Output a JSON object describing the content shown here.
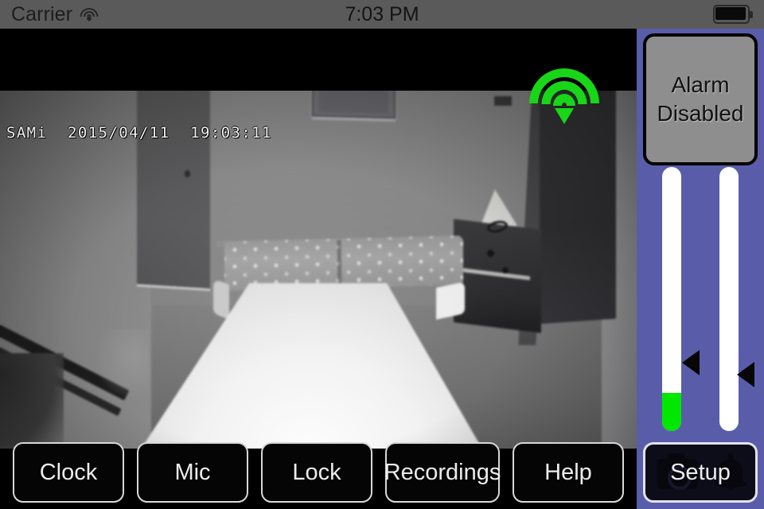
{
  "status_bar": {
    "carrier": "Carrier",
    "wifi_icon": "wifi-icon",
    "time": "7:03 PM",
    "battery_icon": "battery-full-icon"
  },
  "video": {
    "overlay_timestamp": "SAMi  2015/04/11  19:03:11",
    "camera_name": "SAMi",
    "date": "2015/04/11",
    "time": "19:03:11",
    "signal_icon": "wifi-signal-icon",
    "signal_color": "#18d618",
    "scene_description": "night-vision bedroom view"
  },
  "toolbar": {
    "buttons": [
      {
        "label": "Clock",
        "name": "clock-button"
      },
      {
        "label": "Mic",
        "name": "mic-button"
      },
      {
        "label": "Lock",
        "name": "lock-button"
      },
      {
        "label": "Recordings",
        "name": "recordings-button"
      },
      {
        "label": "Help",
        "name": "help-button"
      }
    ]
  },
  "panel": {
    "background_color": "#595DA9",
    "alarm": {
      "line1": "Alarm",
      "line2": "Disabled",
      "background_color": "#8E8E8E"
    },
    "sliders": [
      {
        "name": "sensitivity-slider",
        "fill_color": "#00E800",
        "fill_percent": 13,
        "marker_percent": 31
      },
      {
        "name": "volume-slider",
        "fill_color": "#FFFFFF",
        "fill_percent": 0,
        "marker_percent": 26
      }
    ],
    "setup": {
      "label": "Setup",
      "camera_icon": "camera-icon",
      "bell_icon": "bell-icon"
    }
  }
}
